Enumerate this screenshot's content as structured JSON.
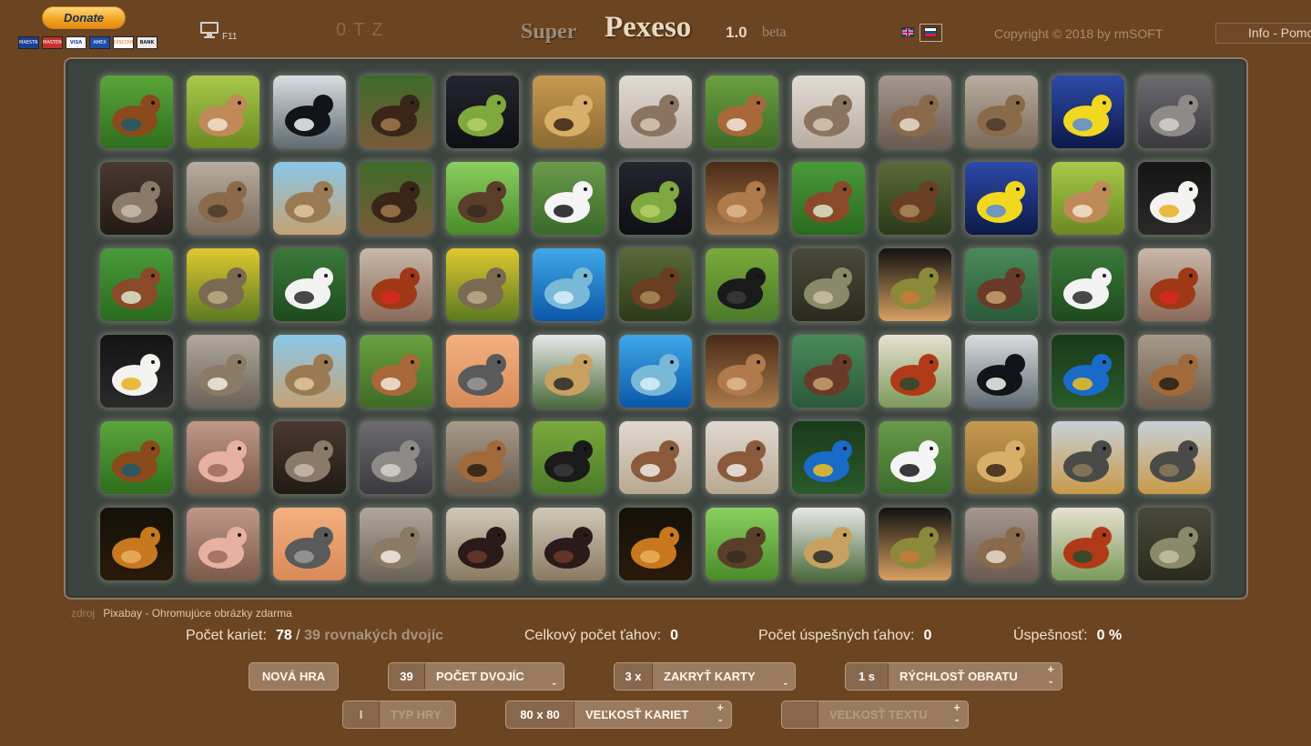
{
  "header": {
    "donate_label": "Donate",
    "payment_cards": [
      "MAESTRO",
      "MASTERCARD",
      "VISA",
      "AMEX",
      "DISCOVER",
      "BANK"
    ],
    "fullscreen_key": "F11",
    "otz": [
      "0",
      "T",
      "Z"
    ],
    "title_super": "Super",
    "title_main": "Pexeso",
    "version": "1.0",
    "beta": "beta",
    "copyright": "Copyright © 2018 by rmSOFT",
    "info_label": "Info - Pomoc"
  },
  "colors": {
    "background": "#6b4422",
    "board": "#3c443f",
    "button": "#9b7b5f"
  },
  "board": {
    "rows": 6,
    "cols": 13,
    "cards": [
      [
        "pheasant",
        "cougar",
        "orca",
        "moose",
        "frog",
        "cheetah",
        "hedgehog",
        "antelope",
        "hedgehog",
        "cat",
        "hyena",
        "yellow-fish",
        "koala"
      ],
      [
        "wolf",
        "hyena",
        "ground-squirrel",
        "moose",
        "beaver",
        "stork",
        "frog",
        "mouse",
        "beetle",
        "cow",
        "yellow-fish",
        "cougar",
        "eagle"
      ],
      [
        "beetle",
        "rabbit",
        "spoonbill",
        "hen",
        "rabbit",
        "dolphin",
        "cow",
        "crow",
        "snake",
        "lizard",
        "turtle",
        "spoonbill",
        "hen"
      ],
      [
        "eagle",
        "falcon",
        "ground-squirrel",
        "antelope",
        "seal",
        "leopard",
        "dolphin",
        "mouse",
        "turtle",
        "rooster",
        "orca",
        "parrot",
        "dog"
      ],
      [
        "pheasant",
        "pig",
        "wolf",
        "koala",
        "dog",
        "crow",
        "porcupine",
        "porcupine",
        "parrot",
        "stork",
        "cheetah",
        "wildebeest",
        "wildebeest"
      ],
      [
        "lion",
        "pig",
        "seal",
        "falcon",
        "stag-beetle",
        "stag-beetle",
        "lion",
        "beaver",
        "leopard",
        "lizard",
        "cat",
        "rooster",
        "snake"
      ]
    ]
  },
  "source": {
    "label": "zdroj",
    "link": "Pixabay - Ohromujúce obrázky zdarma"
  },
  "stats": {
    "cards_label": "Počet kariet:",
    "cards_value": "78",
    "pairs_text": "39 rovnakých dvojíc",
    "moves_label": "Celkový počet ťahov:",
    "moves_value": "0",
    "success_label": "Počet úspešných ťahov:",
    "success_value": "0",
    "rate_label": "Úspešnosť:",
    "rate_value": "0 %"
  },
  "controls": {
    "new_game": "NOVÁ HRA",
    "pairs_value": "39",
    "pairs_label": "POČET DVOJÍC",
    "hide_value": "3 x",
    "hide_label": "ZAKRYŤ KARTY",
    "speed_value": "1 s",
    "speed_label": "RÝCHLOSŤ OBRATU",
    "game_type_value": "I",
    "game_type_label": "TYP HRY",
    "card_size_value": "80 x 80",
    "card_size_label": "VEĽKOSŤ KARIET",
    "text_size_value": "",
    "text_size_label": "VEĽKOSŤ TEXTU",
    "plus": "+",
    "minus": "-"
  }
}
